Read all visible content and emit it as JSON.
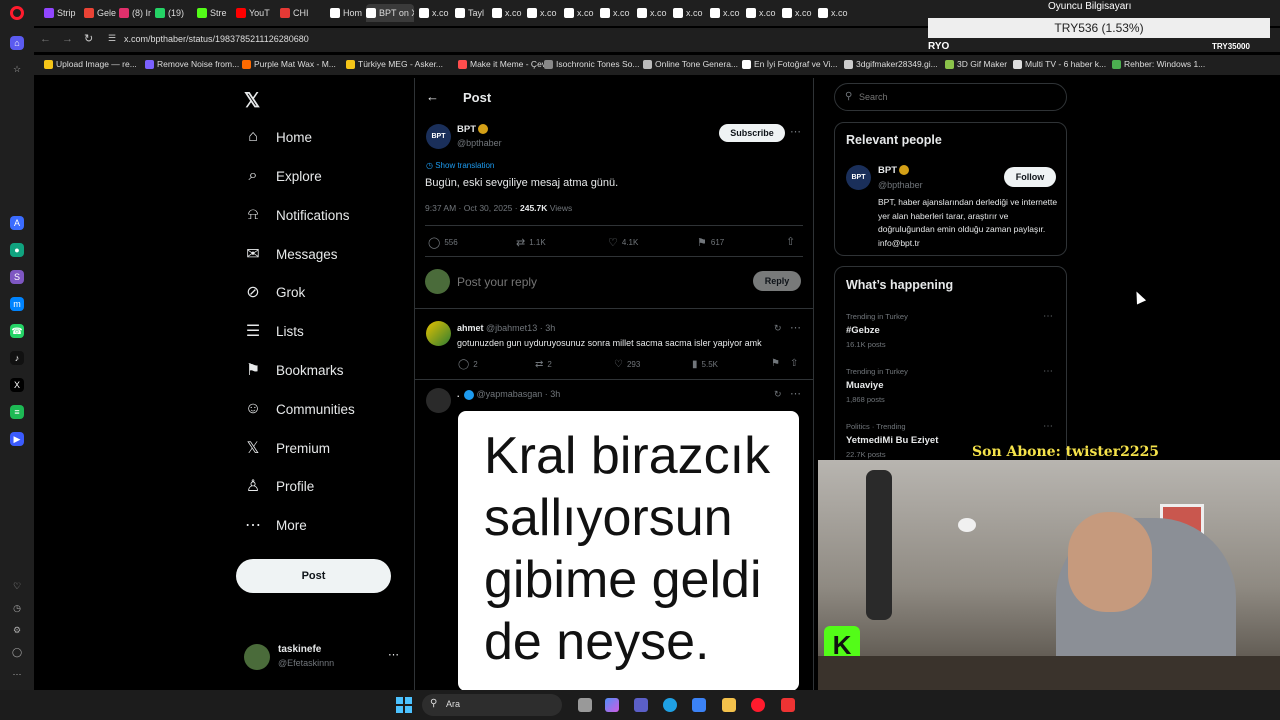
{
  "browser": {
    "tabs": [
      {
        "label": "Strip",
        "color": "#9146ff"
      },
      {
        "label": "Gele",
        "color": "#ea4335"
      },
      {
        "label": "(8) Ir",
        "color": "#e1306c"
      },
      {
        "label": "(19)",
        "color": "#25d366"
      },
      {
        "label": "Stre",
        "color": "#53fc18"
      },
      {
        "label": "YouT",
        "color": "#ff0000"
      },
      {
        "label": "CHI",
        "color": "#e53935"
      },
      {
        "label": "Hom",
        "color": "#ffffff"
      },
      {
        "label": "BPT on X",
        "color": "#ffffff"
      },
      {
        "label": "x.co",
        "color": "#ffffff"
      },
      {
        "label": "Tayl",
        "color": "#ffffff"
      },
      {
        "label": "x.co",
        "color": "#ffffff"
      },
      {
        "label": "x.co",
        "color": "#ffffff"
      },
      {
        "label": "x.co",
        "color": "#ffffff"
      },
      {
        "label": "x.co",
        "color": "#ffffff"
      },
      {
        "label": "x.co",
        "color": "#ffffff"
      },
      {
        "label": "x.co",
        "color": "#ffffff"
      },
      {
        "label": "x.co",
        "color": "#ffffff"
      },
      {
        "label": "x.co",
        "color": "#ffffff"
      },
      {
        "label": "x.co",
        "color": "#ffffff"
      },
      {
        "label": "x.co",
        "color": "#ffffff"
      }
    ],
    "url": "x.com/bpthaber/status/1983785211126280680",
    "bookmarks": [
      {
        "label": "Upload Image — re...",
        "color": "#f5c518"
      },
      {
        "label": "Remove Noise from...",
        "color": "#7b61ff"
      },
      {
        "label": "Purple Mat Wax - M...",
        "color": "#ff6a00"
      },
      {
        "label": "Türkiye MEG - Asker...",
        "color": "#f5c518"
      },
      {
        "label": "Make it Meme - Çev...",
        "color": "#ff4d4d"
      },
      {
        "label": "Isochronic Tones So...",
        "color": "#888888"
      },
      {
        "label": "Online Tone Genera...",
        "color": "#bbbbbb"
      },
      {
        "label": "En İyi Fotoğraf ve Vi...",
        "color": "#ffffff"
      },
      {
        "label": "3dgifmaker28349.gi...",
        "color": "#cccccc"
      },
      {
        "label": "3D Gif Maker",
        "color": "#8bc34a"
      },
      {
        "label": "Multi TV - 6 haber k...",
        "color": "#dddddd"
      },
      {
        "label": "Rehber: Windows 1...",
        "color": "#4caf50"
      }
    ]
  },
  "nav": {
    "items": [
      {
        "label": "Home",
        "icon": "home-icon"
      },
      {
        "label": "Explore",
        "icon": "search-icon"
      },
      {
        "label": "Notifications",
        "icon": "bell-icon"
      },
      {
        "label": "Messages",
        "icon": "envelope-icon"
      },
      {
        "label": "Grok",
        "icon": "grok-icon"
      },
      {
        "label": "Lists",
        "icon": "list-icon"
      },
      {
        "label": "Bookmarks",
        "icon": "bookmark-icon"
      },
      {
        "label": "Communities",
        "icon": "people-icon"
      },
      {
        "label": "Premium",
        "icon": "x-icon"
      },
      {
        "label": "Profile",
        "icon": "person-icon"
      },
      {
        "label": "More",
        "icon": "more-icon"
      }
    ],
    "post_label": "Post",
    "account": {
      "name": "taskinefe",
      "handle": "@Efetaskinnn"
    }
  },
  "post": {
    "header_title": "Post",
    "author": "BPT",
    "handle": "@bpthaber",
    "subscribe_label": "Subscribe",
    "show_translation": "Show translation",
    "text": "Bugün, eski sevgiliye mesaj atma günü.",
    "timestamp": "9:37 AM · Oct 30, 2025 ·",
    "views_count": "245.7K",
    "views_label": "Views",
    "stats": {
      "replies": "556",
      "reposts": "1.1K",
      "likes": "4.1K",
      "bookmarks": "617"
    },
    "reply_placeholder": "Post your reply",
    "reply_button": "Reply"
  },
  "replies": [
    {
      "name": "ahmet",
      "handle": "@jbahmet13 · 3h",
      "text": "gotunuzden gun uyduruyosunuz sonra millet sacma sacma isler yapiyor amk",
      "stats": {
        "replies": "2",
        "reposts": "2",
        "likes": "293",
        "views": "5.5K"
      }
    },
    {
      "name": ".",
      "handle": "@yapmabasgan · 3h",
      "meme_text": "Kral birazcık sallıyorsun gibime geldi de neyse."
    }
  ],
  "right": {
    "search_placeholder": "Search",
    "relevant_title": "Relevant people",
    "person": {
      "name": "BPT",
      "handle": "@bpthaber",
      "follow_label": "Follow",
      "bio": "BPT, haber ajanslarından derlediği ve internette yer alan haberleri tarar, araştırır ve doğruluğundan emin olduğu zaman paylaşır. info@bpt.tr"
    },
    "happening_title": "What’s happening",
    "trends": [
      {
        "meta": "Trending in Turkey",
        "name": "#Gebze",
        "posts": "16.1K posts"
      },
      {
        "meta": "Trending in Turkey",
        "name": "Muaviye",
        "posts": "1,868 posts"
      },
      {
        "meta": "Politics · Trending",
        "name": "YetmediMi Bu Eziyet",
        "posts": "22.7K posts"
      }
    ]
  },
  "overlays": {
    "ticker": "TRY536 (1.53%)",
    "top_right_text": "Oyuncu Bilgisayarı",
    "ryo_label": "RYO",
    "try_label": "TRY35000",
    "subscriber_line": "Son Abone: twister2225"
  },
  "taskbar": {
    "search_label": "Ara"
  },
  "colors": {
    "accent": "#1d9bf0",
    "gold_verified": "#d4a017",
    "subscriber_text": "#f5e24a"
  }
}
